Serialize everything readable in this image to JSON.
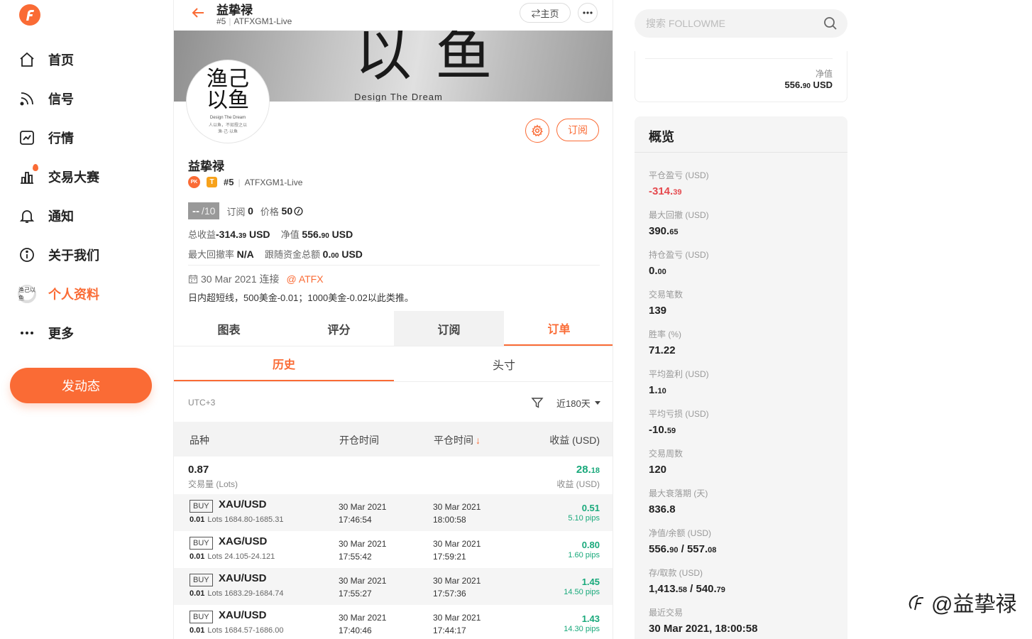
{
  "sidebar": {
    "items": [
      {
        "label": "首页",
        "icon": "home-icon"
      },
      {
        "label": "信号",
        "icon": "rss-icon"
      },
      {
        "label": "行情",
        "icon": "chart-icon"
      },
      {
        "label": "交易大赛",
        "icon": "contest-icon"
      },
      {
        "label": "通知",
        "icon": "bell-icon"
      },
      {
        "label": "关于我们",
        "icon": "info-icon"
      },
      {
        "label": "个人资料",
        "icon": "avatar"
      },
      {
        "label": "更多",
        "icon": "more-icon"
      }
    ],
    "post_button": "发动态",
    "avatar_text": "渔己以鱼"
  },
  "topbar": {
    "name": "益挚禄",
    "rank": "#5",
    "account": "ATFXGM1-Live",
    "home_label": "⇄主页"
  },
  "banner": {
    "big_text": "以 鱼",
    "small_text": "Design The Dream"
  },
  "avatar": {
    "main": "渔己\n以鱼",
    "sub": "Design The Dream",
    "bottom": "人以鱼，不如授之以\n渔·己·以鱼"
  },
  "profile": {
    "subscribe_label": "订阅",
    "name": "益挚禄",
    "rank": "#5",
    "account": "ATFXGM1-Live",
    "badge_pk": "PK",
    "badge_t": "T",
    "score": "--",
    "score_den": "/10",
    "subs_label": "订阅",
    "subs_value": "0",
    "price_label": "价格",
    "price_value": "50",
    "total_profit_label": "总收益",
    "total_profit_int": "-314.",
    "total_profit_dec": "39",
    "total_profit_unit": " USD",
    "net_label": "净值",
    "net_int": "556.",
    "net_dec": "90",
    "net_unit": " USD",
    "max_dd_label": "最大回撤率",
    "max_dd_value": "N/A",
    "follow_label": "跟随资金总额",
    "follow_int": "0.",
    "follow_dec": "00",
    "follow_unit": " USD",
    "date_text": "30 Mar 2021 连接",
    "broker": "@ ATFX",
    "description": "日内超短线，500美金-0.01；1000美金-0.02以此类推。"
  },
  "tabs": [
    "图表",
    "评分",
    "订阅",
    "订单"
  ],
  "subtabs": [
    "历史",
    "头寸"
  ],
  "filter": {
    "timezone": "UTC+3",
    "period": "近180天"
  },
  "table": {
    "headers": [
      "品种",
      "开仓时间",
      "平仓时间",
      "收益 (USD)"
    ],
    "sort_arrow": "↓",
    "summary": {
      "lots": "0.87",
      "lots_label": "交易量 (Lots)",
      "profit_int": "28.",
      "profit_dec": "18",
      "profit_label": "收益 (USD)"
    },
    "rows": [
      {
        "side": "BUY",
        "symbol": "XAU/USD",
        "lots": "0.01",
        "lots_unit": "Lots",
        "range": "1684.80-1685.31",
        "open_date": "30 Mar 2021",
        "open_time": "17:46:54",
        "close_date": "30 Mar 2021",
        "close_time": "18:00:58",
        "pnl": "0.51",
        "pips": "5.10 pips"
      },
      {
        "side": "BUY",
        "symbol": "XAG/USD",
        "lots": "0.01",
        "lots_unit": "Lots",
        "range": "24.105-24.121",
        "open_date": "30 Mar 2021",
        "open_time": "17:55:42",
        "close_date": "30 Mar 2021",
        "close_time": "17:59:21",
        "pnl": "0.80",
        "pips": "1.60 pips"
      },
      {
        "side": "BUY",
        "symbol": "XAU/USD",
        "lots": "0.01",
        "lots_unit": "Lots",
        "range": "1683.29-1684.74",
        "open_date": "30 Mar 2021",
        "open_time": "17:55:27",
        "close_date": "30 Mar 2021",
        "close_time": "17:57:36",
        "pnl": "1.45",
        "pips": "14.50 pips"
      },
      {
        "side": "BUY",
        "symbol": "XAU/USD",
        "lots": "0.01",
        "lots_unit": "Lots",
        "range": "1684.57-1686.00",
        "open_date": "30 Mar 2021",
        "open_time": "17:40:46",
        "close_date": "30 Mar 2021",
        "close_time": "17:44:17",
        "pnl": "1.43",
        "pips": "14.30 pips"
      }
    ]
  },
  "search": {
    "placeholder": "搜索 FOLLOWME"
  },
  "net_card": {
    "label": "净值",
    "value_int": "556.",
    "value_dec": "90",
    "value_unit": " USD"
  },
  "overview": {
    "title": "概览",
    "items": [
      {
        "label": "平仓盈亏 (USD)",
        "int": "-314.",
        "dec": "39",
        "neg": true
      },
      {
        "label": "最大回撤 (USD)",
        "int": "390.",
        "dec": "65"
      },
      {
        "label": "持仓盈亏 (USD)",
        "int": "0.",
        "dec": "00"
      },
      {
        "label": "交易笔数",
        "int": "139",
        "dec": ""
      },
      {
        "label": "胜率 (%)",
        "int": "71.22",
        "dec": ""
      },
      {
        "label": "平均盈利 (USD)",
        "int": "1.",
        "dec": "10"
      },
      {
        "label": "平均亏损 (USD)",
        "int": "-10.",
        "dec": "59"
      },
      {
        "label": "交易周数",
        "int": "120",
        "dec": ""
      },
      {
        "label": "最大衰落期 (天)",
        "int": "836.8",
        "dec": ""
      },
      {
        "label": "净值/余额 (USD)",
        "int": "556.",
        "dec": "90",
        "int2": " / 557.",
        "dec2": "08"
      },
      {
        "label": "存/取款 (USD)",
        "int": "1,413.",
        "dec": "58",
        "int2": " / 540.",
        "dec2": "79"
      },
      {
        "label": "最近交易",
        "int": "30 Mar 2021, 18:00:58",
        "dec": ""
      }
    ]
  },
  "watermark": "@益挚禄",
  "colors": {
    "accent": "#fa6b35",
    "profit": "#19a97b",
    "loss": "#e5484d"
  }
}
